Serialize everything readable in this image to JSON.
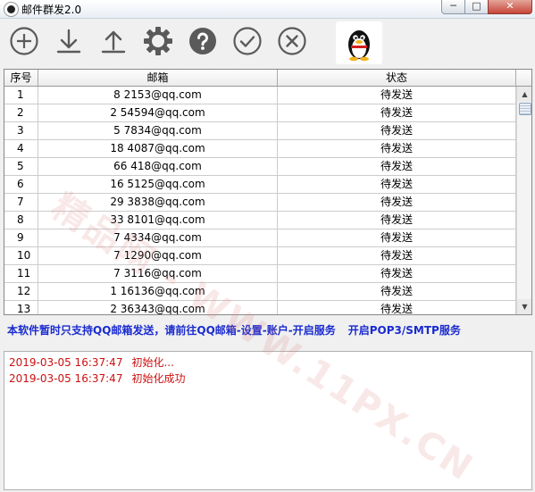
{
  "window": {
    "title": "邮件群发2.0",
    "min_label": "─",
    "max_label": "□",
    "close_label": "✕"
  },
  "toolbar": {
    "items": [
      {
        "icon": "add-icon"
      },
      {
        "icon": "download-icon"
      },
      {
        "icon": "upload-icon"
      },
      {
        "icon": "gear-icon"
      },
      {
        "icon": "help-icon"
      },
      {
        "icon": "check-icon"
      },
      {
        "icon": "cancel-icon"
      }
    ],
    "qq_icon": "qq-penguin-icon"
  },
  "table": {
    "headers": {
      "index": "序号",
      "email": "邮箱",
      "status": "状态"
    },
    "rows": [
      {
        "index": "1",
        "email": "8   2153@qq.com",
        "status": "待发送"
      },
      {
        "index": "2",
        "email": "2   54594@qq.com",
        "status": "待发送"
      },
      {
        "index": "3",
        "email": "5   7834@qq.com",
        "status": "待发送"
      },
      {
        "index": "4",
        "email": "18   4087@qq.com",
        "status": "待发送"
      },
      {
        "index": "5",
        "email": "66   418@qq.com",
        "status": "待发送"
      },
      {
        "index": "6",
        "email": "16   5125@qq.com",
        "status": "待发送"
      },
      {
        "index": "7",
        "email": "29   3838@qq.com",
        "status": "待发送"
      },
      {
        "index": "8",
        "email": "33   8101@qq.com",
        "status": "待发送"
      },
      {
        "index": "9",
        "email": "7   4334@qq.com",
        "status": "待发送"
      },
      {
        "index": "10",
        "email": "7   1290@qq.com",
        "status": "待发送"
      },
      {
        "index": "11",
        "email": "7   3116@qq.com",
        "status": "待发送"
      },
      {
        "index": "12",
        "email": "1   16136@qq.com",
        "status": "待发送"
      },
      {
        "index": "13",
        "email": "2   36343@qq.com",
        "status": "待发送"
      }
    ]
  },
  "info": {
    "text1": "本软件暂时只支持QQ邮箱发送，请前往QQ邮箱-设置-账户-开启服务",
    "text2": "开启POP3/SMTP服务"
  },
  "log": [
    {
      "time": "2019-03-05 16:37:47",
      "message": "初始化..."
    },
    {
      "time": "2019-03-05 16:37:47",
      "message": "初始化成功"
    }
  ],
  "watermark": "精品网 - WWW.11PX.CN",
  "colors": {
    "info_text": "#1a2bd0",
    "log_text": "#cc1010",
    "icon": "#5a5a5a"
  }
}
